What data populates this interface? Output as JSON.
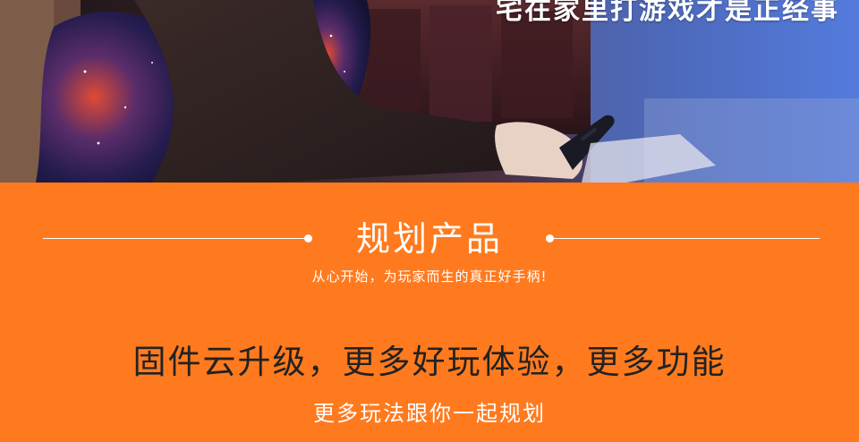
{
  "hero": {
    "caption": "宅在家里打游戏才是正经事"
  },
  "section": {
    "title": "规划产品",
    "subtitle": "从心开始，为玩家而生的真正好手柄!"
  },
  "feature": {
    "headline": "固件云升级，更多好玩体验，更多功能",
    "subheadline": "更多玩法跟你一起规划"
  },
  "colors": {
    "accent_orange": "#ff7a1e",
    "headline_text": "#222222",
    "white": "#ffffff"
  }
}
